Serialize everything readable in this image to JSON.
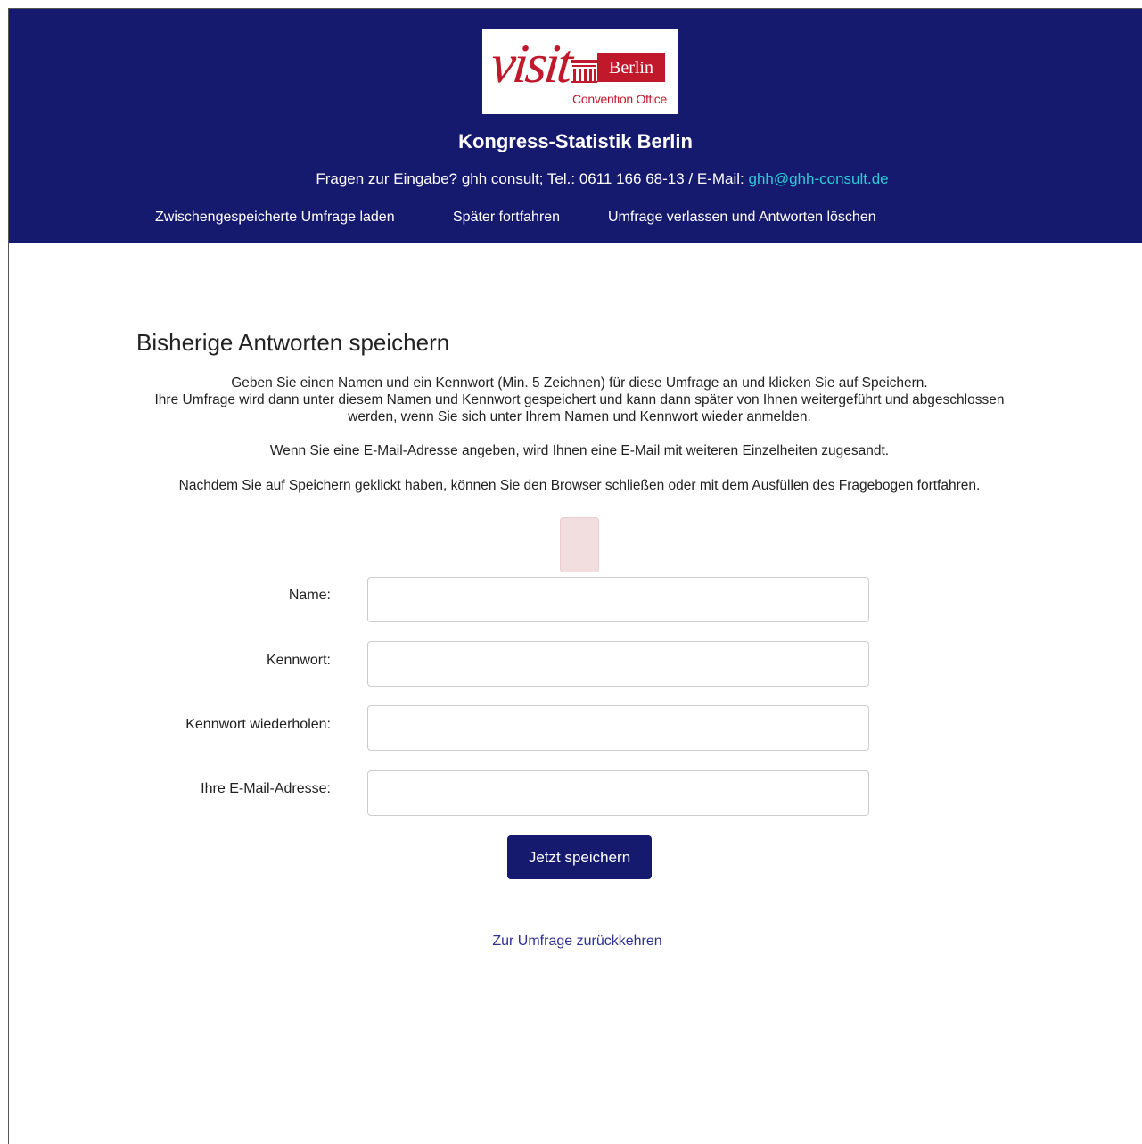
{
  "logo": {
    "visit_text": "visit",
    "berlin_text": "Berlin",
    "subtitle": "Convention Office"
  },
  "header": {
    "survey_title": "Kongress-Statistik Berlin",
    "contact_text": "Fragen zur Eingabe? ghh consult; Tel.: 0611 166 68-13 / E-Mail:",
    "contact_email": "ghh@ghh-consult.de",
    "nav": {
      "load": "Zwischengespeicherte Umfrage laden",
      "resume_later": "Später fortfahren",
      "exit": "Umfrage verlassen und Antworten löschen"
    }
  },
  "main": {
    "heading": "Bisherige Antworten speichern",
    "intro_line1": "Geben Sie einen Namen und ein Kennwort (Min. 5 Zeichnen) für diese Umfrage an und klicken Sie auf Speichern.",
    "intro_line2": "Ihre Umfrage wird dann unter diesem Namen und Kennwort gespeichert und kann dann später von Ihnen weitergeführt und abgeschlossen werden, wenn Sie sich unter Ihrem Namen und Kennwort wieder anmelden.",
    "email_note": "Wenn Sie eine E-Mail-Adresse angeben, wird Ihnen eine E-Mail mit weiteren Einzelheiten zugesandt.",
    "after_save_note": "Nachdem Sie auf Speichern geklickt haben, können Sie den Browser schließen oder mit dem Ausfüllen des Fragebogen fortfahren."
  },
  "form": {
    "name_label": "Name:",
    "name_value": "",
    "password_label": "Kennwort:",
    "password_value": "",
    "password_repeat_label": "Kennwort wiederholen:",
    "password_repeat_value": "",
    "email_label": "Ihre E-Mail-Adresse:",
    "email_value": "",
    "save_button": "Jetzt speichern",
    "back_link": "Zur Umfrage zurückkehren"
  },
  "colors": {
    "header_bg": "#161a6e",
    "brand_red": "#c0192c",
    "email_link": "#2ec9d6",
    "link": "#2e3192"
  }
}
